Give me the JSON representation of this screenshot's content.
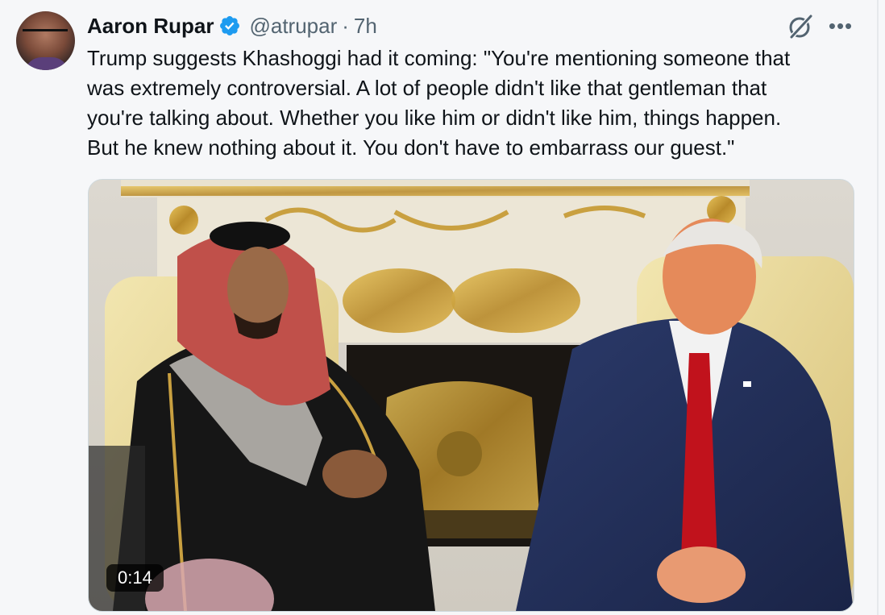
{
  "tweet": {
    "author": {
      "display_name": "Aaron Rupar",
      "handle": "@atrupar",
      "verified": true
    },
    "separator": "·",
    "time": "7h",
    "text_lines": [
      "Trump suggests Khashoggi had it coming: \"You're mentioning someone that",
      "was extremely controversial. A lot of people didn't like that gentleman that",
      "you're talking about. Whether you like him or didn't like him, things happen.",
      "But he knew nothing about it. You don't have to embarrass our guest.\""
    ],
    "media": {
      "type": "video",
      "duration": "0:14"
    }
  },
  "icons": {
    "verified": "verified-badge-icon",
    "grok": "grok-icon",
    "more": "more-options-icon"
  },
  "colors": {
    "verified_blue": "#1d9bf0",
    "text_primary": "#0f1419",
    "text_secondary": "#536471",
    "background": "#f6f7f9"
  }
}
